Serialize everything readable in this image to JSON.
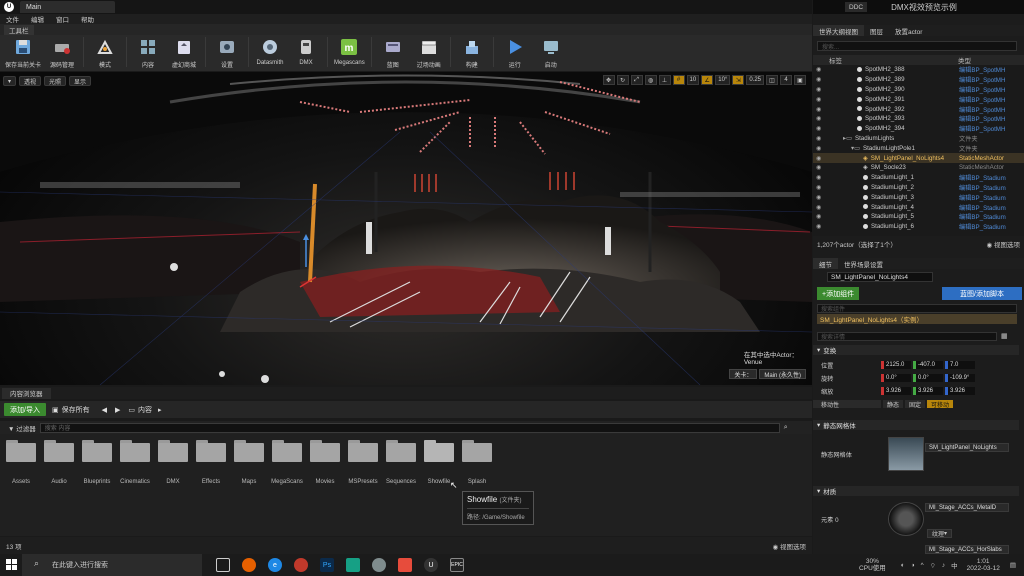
{
  "window": {
    "tab_title": "Main",
    "ue_logo": "U",
    "ddc": "DDC",
    "project": "DMX视效预览示例"
  },
  "menu": [
    "文件",
    "编辑",
    "窗口",
    "帮助"
  ],
  "toolbar_header": "工具栏",
  "toolbar": [
    {
      "label": "保存当前关卡",
      "icon": "save-icon"
    },
    {
      "label": "源码管理",
      "icon": "source-control-icon"
    },
    {
      "label": "模式",
      "icon": "modes-icon"
    },
    {
      "label": "内容",
      "icon": "content-icon"
    },
    {
      "label": "虚幻商城",
      "icon": "marketplace-icon"
    },
    {
      "label": "设置",
      "icon": "settings-icon"
    },
    {
      "label": "Datasmith",
      "icon": "datasmith-icon"
    },
    {
      "label": "DMX",
      "icon": "dmx-icon"
    },
    {
      "label": "Megascans",
      "icon": "megascans-icon"
    },
    {
      "label": "蓝图",
      "icon": "blueprint-icon"
    },
    {
      "label": "过场动画",
      "icon": "cinematics-icon"
    },
    {
      "label": "构建",
      "icon": "build-icon"
    },
    {
      "label": "运行",
      "icon": "play-icon"
    },
    {
      "label": "启动",
      "icon": "launch-icon"
    }
  ],
  "viewport": {
    "buttons": [
      "透视",
      "光照",
      "显示"
    ],
    "right_values": [
      "10",
      "10°",
      "0.25",
      "4"
    ],
    "info_line1": "在其中选中Actor：",
    "info_line2": "Venue",
    "chip1": "关卡：",
    "chip2": "Main (永久性)"
  },
  "content_browser": {
    "tab": "内容浏览器",
    "add_import": "添加/导入",
    "save_all": "保存所有",
    "path": "内容",
    "filter": "过滤器",
    "search_placeholder": "搜索 内容",
    "folders": [
      "Assets",
      "Audio",
      "Blueprints",
      "Cinematics",
      "DMX",
      "Effects",
      "Maps",
      "MegaScans",
      "Movies",
      "MSPresets",
      "Sequences",
      "Showfile",
      "Splash"
    ],
    "tooltip_title": "Showfile",
    "tooltip_kind": "(文件夹)",
    "tooltip_path": "路径: /Game/Showfile",
    "item_count": "13 项",
    "view_options": "视图选项"
  },
  "outliner": {
    "tabs": [
      "世界大纲视图",
      "图层",
      "放置actor"
    ],
    "search_placeholder": "搜索...",
    "col_label": "标签",
    "col_type": "类型",
    "rows": [
      {
        "name": "SpotMH2_388",
        "type": "编辑BP_SpotMH"
      },
      {
        "name": "SpotMH2_389",
        "type": "编辑BP_SpotMH"
      },
      {
        "name": "SpotMH2_390",
        "type": "编辑BP_SpotMH"
      },
      {
        "name": "SpotMH2_391",
        "type": "编辑BP_SpotMH"
      },
      {
        "name": "SpotMH2_392",
        "type": "编辑BP_SpotMH"
      },
      {
        "name": "SpotMH2_393",
        "type": "编辑BP_SpotMH"
      },
      {
        "name": "SpotMH2_394",
        "type": "编辑BP_SpotMH"
      },
      {
        "name": "StadiumLights",
        "type": "文件夹"
      },
      {
        "name": "StadiumLightPole1",
        "type": "文件夹"
      },
      {
        "name": "SM_LightPanel_NoLights4",
        "type": "StaticMeshActor"
      },
      {
        "name": "SM_Socle23",
        "type": "StaticMeshActor"
      },
      {
        "name": "StadiumLight_1",
        "type": "编辑BP_Stadium"
      },
      {
        "name": "StadiumLight_2",
        "type": "编辑BP_Stadium"
      },
      {
        "name": "StadiumLight_3",
        "type": "编辑BP_Stadium"
      },
      {
        "name": "StadiumLight_4",
        "type": "编辑BP_Stadium"
      },
      {
        "name": "StadiumLight_5",
        "type": "编辑BP_Stadium"
      },
      {
        "name": "StadiumLight_6",
        "type": "编辑BP_Stadium"
      }
    ],
    "footer": "1,207个actor（选择了1个）",
    "view_options": "视图选项"
  },
  "details": {
    "tabs": [
      "细节",
      "世界场景设置"
    ],
    "actor_name": "SM_LightPanel_NoLights4",
    "add_component": "+添加组件",
    "blueprint_btn": "蓝图/添加脚本",
    "comp_search": "搜索组件",
    "comp_selected": "SM_LightPanel_NoLights4（实例）",
    "detail_search": "搜索详情",
    "sec_transform": "变换",
    "location_label": "位置",
    "location": [
      "2125.0",
      "-407.0",
      "7.0"
    ],
    "rotation_label": "旋转",
    "rotation": [
      "0.0°",
      "0.0°",
      "-109.9°"
    ],
    "scale_label": "缩放",
    "scale": [
      "3.926",
      "3.926",
      "3.926"
    ],
    "mobility_label": "移动性",
    "mobility": [
      "静态",
      "固定",
      "可移动"
    ],
    "sec_mesh": "静态网格体",
    "mesh_label": "静态网格体",
    "mesh_value": "SM_LightPanel_NoLights",
    "sec_material": "材质",
    "element0": "元素 0",
    "material1": "MI_Stage_ACCs_MetalD",
    "material2": "MI_Stage_ACCs_HorSlabs",
    "texture_btn": "纹理"
  },
  "taskbar": {
    "search": "在此键入进行搜索",
    "cpu": "30%",
    "cpu_label": "CPU使用",
    "time": "1:01",
    "date": "2022-03-12"
  }
}
